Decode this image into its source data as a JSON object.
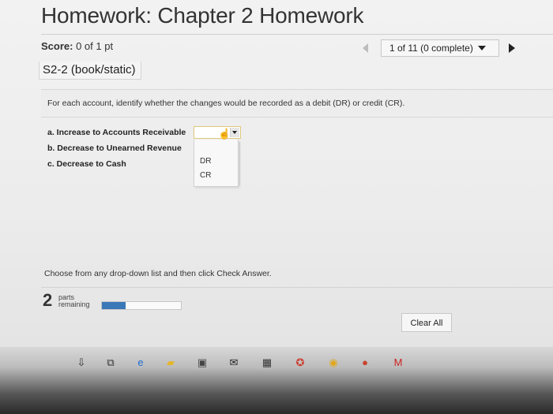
{
  "header": {
    "title": "Homework: Chapter 2 Homework",
    "score_label": "Score:",
    "score_value": "0 of 1 pt"
  },
  "navigator": {
    "question_select": "1 of 11 (0 complete)"
  },
  "question": {
    "id": "S2-2 (book/static)",
    "instruction": "For each account, identify whether the changes would be recorded as a debit (DR) or credit (CR).",
    "items": [
      "a. Increase to Accounts Receivable",
      "b. Decrease to Unearned Revenue",
      "c. Decrease to Cash"
    ],
    "dropdown_options": [
      "DR",
      "CR"
    ]
  },
  "footer": {
    "instruction": "Choose from any drop-down list and then click Check Answer.",
    "parts_count": "2",
    "parts_line1": "parts",
    "parts_line2": "remaining",
    "progress": 0.3,
    "clear_label": "Clear All"
  },
  "colors": {
    "progress_fill": "#3b78b8",
    "dropdown_border": "#e0c77a"
  },
  "taskbar_icons": [
    "upload-icon",
    "task-view-icon",
    "edge-icon",
    "file-explorer-icon",
    "store-icon",
    "mail-icon",
    "calculator-icon",
    "app-icon",
    "chrome-icon",
    "powerpoint-icon",
    "mcafee-icon"
  ]
}
